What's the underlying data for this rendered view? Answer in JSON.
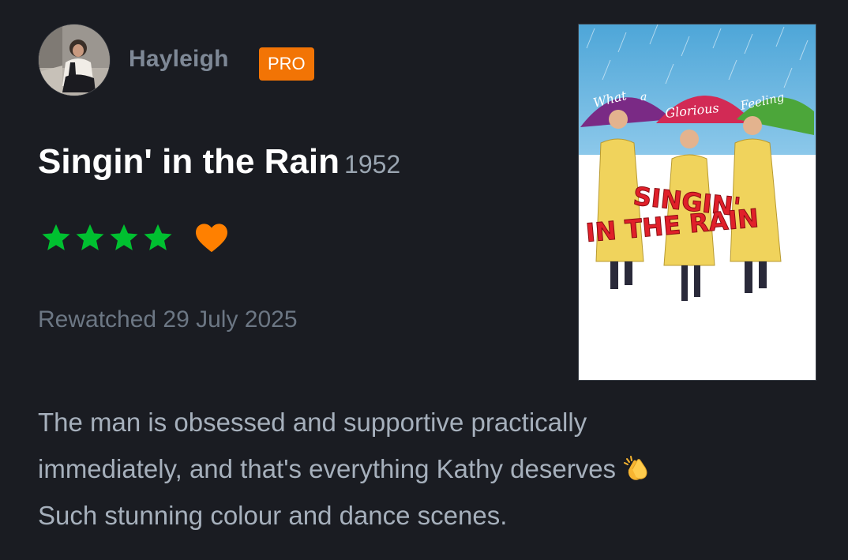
{
  "user": {
    "name": "Hayleigh",
    "badge": "PRO",
    "avatar_icon": "user-avatar-photo"
  },
  "film": {
    "title": "Singin' in the Rain",
    "year": "1952",
    "poster": {
      "tagline_words": [
        "What",
        "a",
        "Glorious",
        "Feeling"
      ],
      "title_line1": "SINGIN'",
      "title_line2": "IN THE RAIN"
    }
  },
  "rating": {
    "stars": 4,
    "max_stars": 5,
    "liked": true,
    "star_color": "#00c030",
    "heart_color": "#ff8000"
  },
  "log": {
    "watch_date": "Rewatched 29 July 2025"
  },
  "review": {
    "lines": [
      "The man is obsessed and supportive practically",
      "immediately, and that's everything Kathy deserves",
      "Such stunning colour and dance scenes."
    ],
    "emoji": "clapping-hands-icon"
  },
  "colors": {
    "background": "#1a1c22",
    "pro_badge": "#f27405",
    "username": "#7e8896",
    "body_text": "#a6b0bc"
  }
}
